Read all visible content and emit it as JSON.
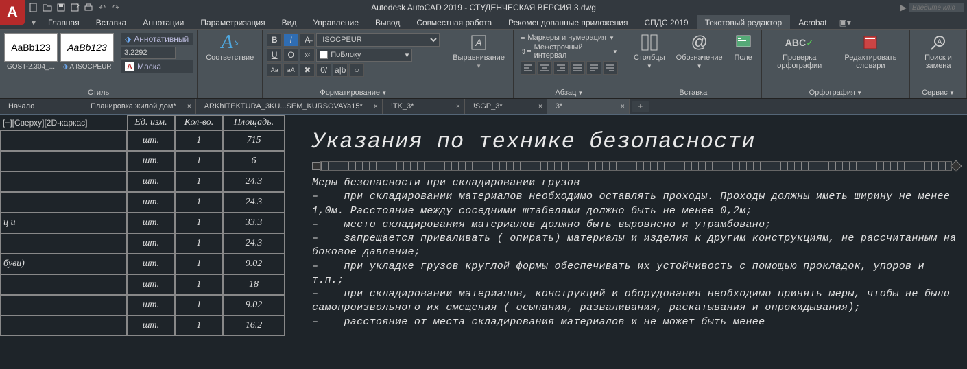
{
  "app": {
    "logo": "A",
    "title": "Autodesk AutoCAD 2019 - СТУДЕНЧЕСКАЯ ВЕРСИЯ   3.dwg",
    "search_placeholder": "Введите клю"
  },
  "menu": {
    "items": [
      "Главная",
      "Вставка",
      "Аннотации",
      "Параметризация",
      "Вид",
      "Управление",
      "Вывод",
      "Совместная работа",
      "Рекомендованные приложения",
      "СПДС 2019",
      "Текстовый редактор",
      "Acrobat"
    ],
    "active_index": 10
  },
  "ribbon": {
    "style": {
      "panel": "Стиль",
      "style1_sample": "AaBb123",
      "style1_name": "GOST-2.304_...",
      "style2_sample": "AaBb123",
      "style2_name": "A ISOCPEUR",
      "annotative": "Аннотативный",
      "height": "3.2292",
      "mask": "Маска"
    },
    "match": {
      "label": "Соответствие"
    },
    "formatting": {
      "panel": "Форматирование",
      "font": "ISOCPEUR",
      "bylayer": "ПоБлоку"
    },
    "justify": {
      "label": "Выравнивание"
    },
    "paragraph": {
      "panel": "Абзац",
      "bullets": "Маркеры и нумерация",
      "spacing": "Межстрочный интервал"
    },
    "insert": {
      "panel": "Вставка",
      "columns": "Столбцы",
      "symbol": "Обозначение",
      "field": "Поле"
    },
    "spelling": {
      "panel": "Орфография",
      "check": "Проверка орфографии",
      "dict": "Редактировать словари"
    },
    "tools": {
      "panel": "Сервис",
      "find": "Поиск и замена"
    }
  },
  "doctabs": {
    "items": [
      "Начало",
      "Планировка жилой дом*",
      "ARKhITEKTURA_3KU...SEM_KURSOVAYa15*",
      "!TK_3*",
      "!SGP_3*",
      "3*"
    ],
    "active_index": 5
  },
  "viewport_label": "[−][Сверху][2D-каркас]",
  "table": {
    "headers": [
      "",
      "Ед. изм.",
      "Кол-во.",
      "Площадь."
    ],
    "rows": [
      [
        "",
        "шт.",
        "1",
        "715"
      ],
      [
        "",
        "шт.",
        "1",
        "6"
      ],
      [
        "",
        "шт.",
        "1",
        "24.3"
      ],
      [
        "",
        "шт.",
        "1",
        "24.3"
      ],
      [
        "ц и",
        "шт.",
        "1",
        "33.3"
      ],
      [
        "",
        "шт.",
        "1",
        "24.3"
      ],
      [
        "буви)",
        "шт.",
        "1",
        "9.02"
      ],
      [
        "",
        "шт.",
        "1",
        "18"
      ],
      [
        "",
        "шт.",
        "1",
        "9.02"
      ],
      [
        "",
        "шт.",
        "1",
        "16.2"
      ]
    ]
  },
  "text_editor": {
    "title": "Указания по технике безопасности",
    "body": "Меры безопасности при складировании грузов\n–    при складировании материалов необходимо оставлять проходы. Проходы должны иметь ширину не менее 1,0м. Расстояние между соседними штабелями должно быть не менее 0,2м;\n–    место складирования материалов должно быть выровнено и утрамбовано;\n–    запрещается приваливать ( опирать) материалы и изделия к другим конструкциям, не рассчитанным на боковое давление;\n–    при укладке грузов круглой формы обеспечивать их устойчивость с помощью прокладок, упоров и т.п.;\n–    при складировании материалов, конструкций и оборудования необходимо принять меры, чтобы не было самопроизвольного их смещения ( осыпания, разваливания, раскатывания и опрокидывания);\n–    расстояние от места складирования материалов и не может быть менее"
  }
}
